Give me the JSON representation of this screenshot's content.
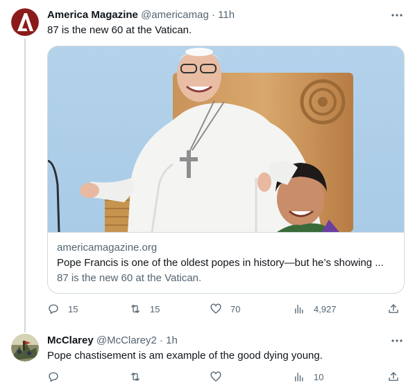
{
  "tweets": [
    {
      "author_name": "America Magazine",
      "handle": "@americamag",
      "time": "11h",
      "text": "87 is the new 60 at the Vatican.",
      "card": {
        "domain": "americamagazine.org",
        "title": "Pope Francis is one of the oldest popes in history—but he’s showing ...",
        "description": "87 is the new 60 at the Vatican."
      },
      "stats": {
        "replies": "15",
        "retweets": "15",
        "likes": "70",
        "views": "4,927"
      }
    },
    {
      "author_name": "McClarey",
      "handle": "@McClarey2",
      "time": "1h",
      "text": "Pope chastisement is am example of the good dying young.",
      "stats": {
        "replies": "",
        "retweets": "",
        "likes": "",
        "views": "10"
      }
    }
  ],
  "separators": {
    "dot": "·"
  },
  "colors": {
    "text": "#0f1419",
    "secondary": "#536471",
    "border": "#cfd9de",
    "logo_red": "#8b1b1b"
  },
  "icons": [
    "america-logo-icon",
    "more-icon",
    "reply-icon",
    "retweet-icon",
    "like-icon",
    "views-icon",
    "share-icon"
  ]
}
